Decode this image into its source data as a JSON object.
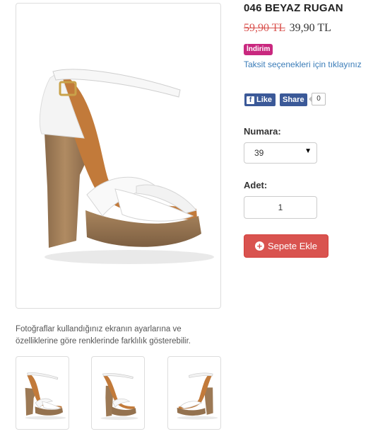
{
  "product": {
    "title": "046 BEYAZ RUGAN",
    "old_price": "59,90 TL",
    "new_price": "39,90 TL",
    "discount_badge": "İndirim",
    "installment_link": "Taksit seçenekleri için tıklayınız"
  },
  "social": {
    "like_label": "Like",
    "share_label": "Share",
    "share_count": "0"
  },
  "options": {
    "size_label": "Numara:",
    "size_value": "39",
    "quantity_label": "Adet:",
    "quantity_value": "1"
  },
  "cart": {
    "add_label": "Sepete Ekle"
  },
  "gallery": {
    "notice": "Fotoğraflar kullandığınız ekranın ayarlarına ve özelliklerine göre renklerinde farklılık gösterebilir.",
    "thumbnails": [
      "thumbnail-1",
      "thumbnail-2",
      "thumbnail-3"
    ]
  },
  "colors": {
    "danger": "#d9534f",
    "badge": "#c9287f",
    "link": "#3a7cb8",
    "facebook": "#3b5998"
  }
}
